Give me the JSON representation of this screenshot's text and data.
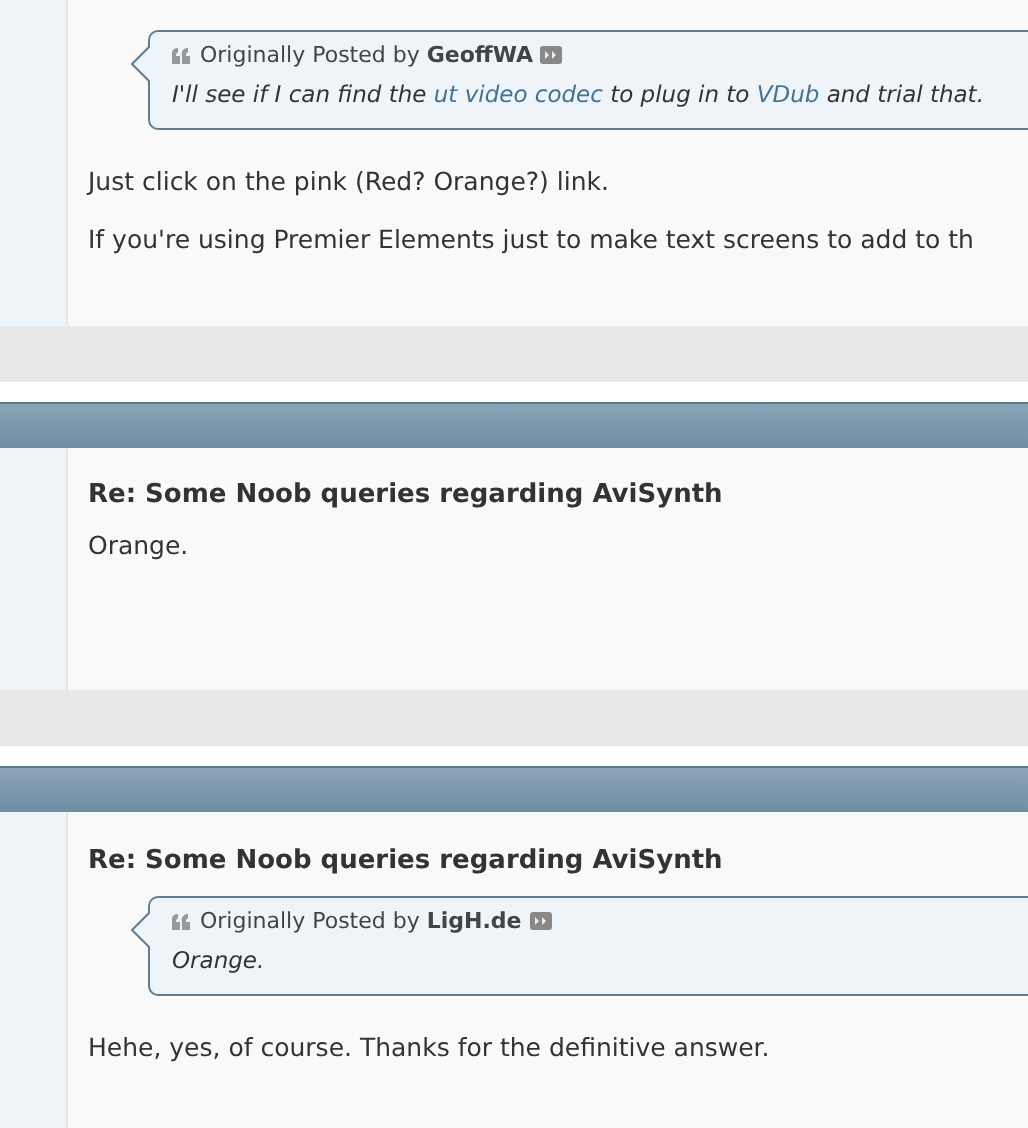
{
  "posts": [
    {
      "quote": {
        "prefix": "Originally Posted by",
        "author": "GeoffWA",
        "body": [
          {
            "kind": "text",
            "text": "I'll see if I can find the "
          },
          {
            "kind": "link",
            "text": "ut video codec"
          },
          {
            "kind": "text",
            "text": " to plug in to "
          },
          {
            "kind": "link",
            "text": "VDub"
          },
          {
            "kind": "text",
            "text": " and trial that."
          }
        ]
      },
      "paragraphs": [
        "Just click on the pink (Red? Orange?) link.",
        "If you're using Premier Elements just to make text screens to add to th"
      ]
    },
    {
      "title": "Re: Some Noob queries regarding AviSynth",
      "paragraphs": [
        "Orange."
      ]
    },
    {
      "title": "Re: Some Noob queries regarding AviSynth",
      "quote": {
        "prefix": "Originally Posted by",
        "author": "LigH.de",
        "body": [
          {
            "kind": "text",
            "text": "Orange."
          }
        ]
      },
      "paragraphs": [
        "Hehe, yes, of course. Thanks for the definitive answer."
      ]
    }
  ]
}
